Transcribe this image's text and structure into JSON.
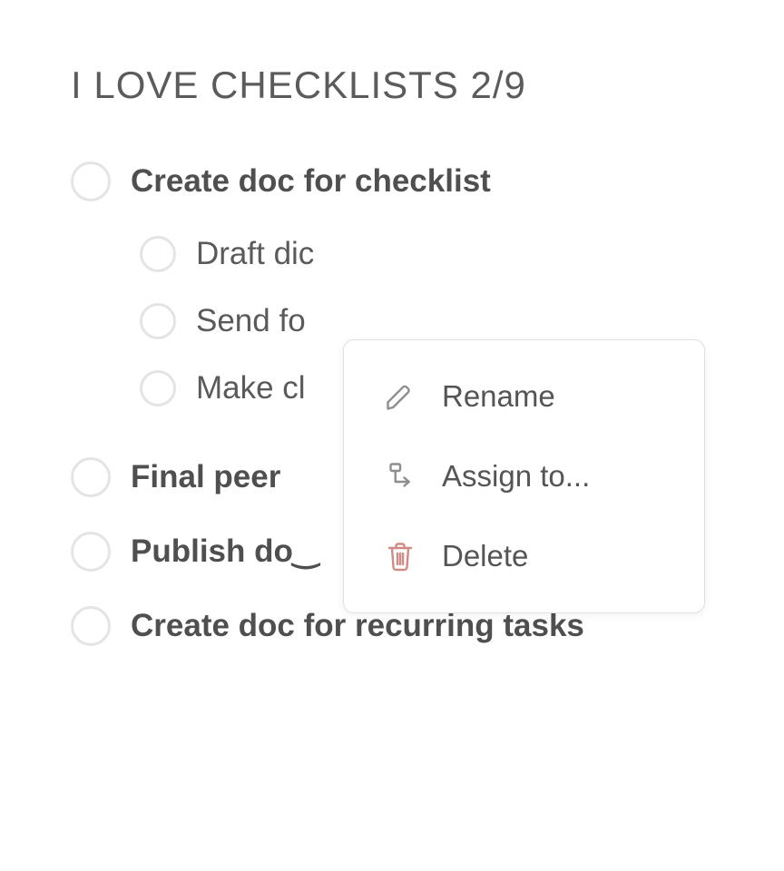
{
  "checklist": {
    "title": "I LOVE CHECKLISTS 2/9",
    "items": [
      {
        "label": "Create doc for checklist",
        "subitems": [
          {
            "label": "Draft dic"
          },
          {
            "label": "Send fo"
          },
          {
            "label": "Make cl"
          }
        ]
      },
      {
        "label": "Final peer"
      },
      {
        "label": "Publish do‿"
      },
      {
        "label": "Create doc for recurring tasks"
      }
    ]
  },
  "context_menu": {
    "rename_label": "Rename",
    "assign_label": "Assign to...",
    "delete_label": "Delete"
  },
  "colors": {
    "text": "#4f4f4f",
    "checkbox_border": "#e4e4e4",
    "delete_accent": "#d08b86"
  }
}
